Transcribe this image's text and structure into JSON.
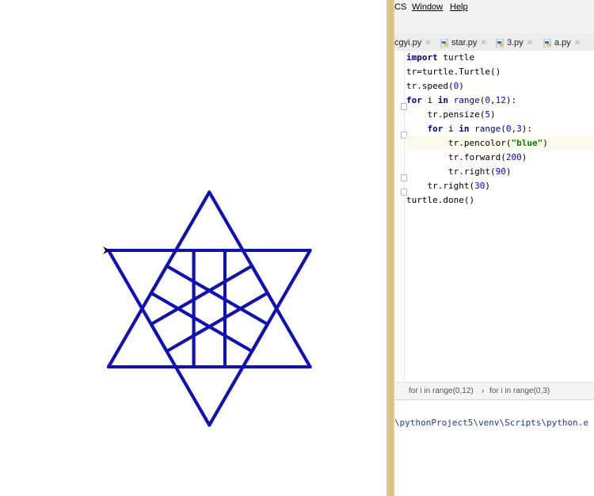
{
  "menu": {
    "vcs_label": "CS",
    "window_label": "Window",
    "help_label": "Help"
  },
  "tabs": [
    {
      "label": "cgyi.py"
    },
    {
      "label": "star.py"
    },
    {
      "label": "3.py"
    },
    {
      "label": "a.py"
    }
  ],
  "editor": {
    "lines": [
      [
        {
          "t": "import",
          "c": "kw"
        },
        {
          "t": " turtle",
          "c": ""
        }
      ],
      [
        {
          "t": "tr=turtle.Turtle()",
          "c": ""
        }
      ],
      [
        {
          "t": "tr.speed(",
          "c": ""
        },
        {
          "t": "0",
          "c": "num"
        },
        {
          "t": ")",
          "c": ""
        }
      ],
      [
        {
          "t": "for",
          "c": "kw"
        },
        {
          "t": " i ",
          "c": ""
        },
        {
          "t": "in",
          "c": "kw"
        },
        {
          "t": " ",
          "c": ""
        },
        {
          "t": "range",
          "c": "bi"
        },
        {
          "t": "(",
          "c": ""
        },
        {
          "t": "0",
          "c": "num"
        },
        {
          "t": ",",
          "c": ""
        },
        {
          "t": "12",
          "c": "num"
        },
        {
          "t": "):",
          "c": ""
        }
      ],
      [
        {
          "t": "    tr.pensize(",
          "c": ""
        },
        {
          "t": "5",
          "c": "num"
        },
        {
          "t": ")",
          "c": ""
        }
      ],
      [
        {
          "t": "    ",
          "c": ""
        },
        {
          "t": "for",
          "c": "kw"
        },
        {
          "t": " i ",
          "c": ""
        },
        {
          "t": "in",
          "c": "kw"
        },
        {
          "t": " ",
          "c": ""
        },
        {
          "t": "range",
          "c": "bi"
        },
        {
          "t": "(",
          "c": ""
        },
        {
          "t": "0",
          "c": "num"
        },
        {
          "t": ",",
          "c": ""
        },
        {
          "t": "3",
          "c": "num"
        },
        {
          "t": "):",
          "c": ""
        }
      ],
      [
        {
          "t": "        tr.pencolor(",
          "c": ""
        },
        {
          "t": "\"blue\"",
          "c": "str"
        },
        {
          "t": ")",
          "c": ""
        }
      ],
      [
        {
          "t": "        tr.forward(",
          "c": ""
        },
        {
          "t": "200",
          "c": "num"
        },
        {
          "t": ")",
          "c": ""
        }
      ],
      [
        {
          "t": "        tr.right(",
          "c": ""
        },
        {
          "t": "90",
          "c": "num"
        },
        {
          "t": ")",
          "c": ""
        }
      ],
      [
        {
          "t": "    tr.right(",
          "c": ""
        },
        {
          "t": "30",
          "c": "num"
        },
        {
          "t": ")",
          "c": ""
        }
      ],
      [
        {
          "t": "turtle.done()",
          "c": ""
        }
      ]
    ],
    "current_line_index": 6
  },
  "breadcrumb": {
    "outer": "for i in range(0,12)",
    "separator": "›",
    "inner": "for i in range(0,3)"
  },
  "run_output": "\\pythonProject5\\venv\\Scripts\\python.e",
  "colors": {
    "pen": "#1010b8",
    "divider_accent": "#e2c080",
    "current_line": "#fcfaed",
    "keyword": "#000080",
    "number": "#0000ff",
    "string": "#008000"
  },
  "icons": {
    "tab_file": "python-file-icon",
    "tab_close": "close-icon",
    "turtle_cursor": "turtle-arrow-icon"
  }
}
